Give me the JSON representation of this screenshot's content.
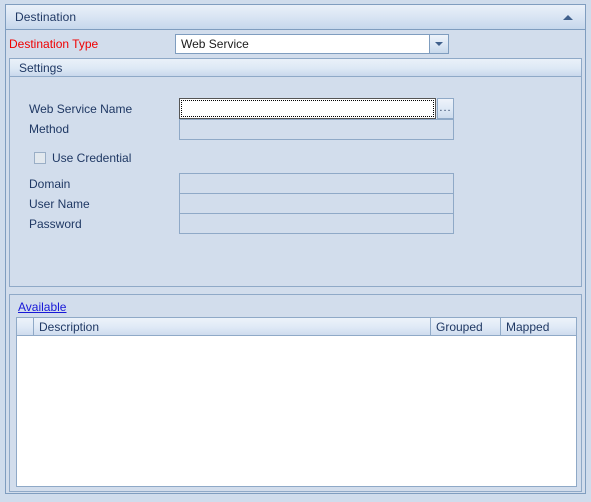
{
  "panel": {
    "title": "Destination",
    "collapse_icon": "chevron-up-icon"
  },
  "destination_type": {
    "label": "Destination Type",
    "label_color": "#f00000",
    "value": "Web Service",
    "dropdown_icon": "chevron-down-icon",
    "options": [
      "Web Service"
    ]
  },
  "settings": {
    "title": "Settings",
    "web_service_name": {
      "label": "Web Service Name",
      "value": "",
      "focused": true,
      "browse_label": "...",
      "browse_icon": "ellipsis-icon"
    },
    "method": {
      "label": "Method",
      "value": "",
      "disabled": true
    },
    "use_credential": {
      "label": "Use Credential",
      "checked": false
    },
    "domain": {
      "label": "Domain",
      "value": "",
      "disabled": true
    },
    "user_name": {
      "label": "User Name",
      "value": "",
      "disabled": true
    },
    "password": {
      "label": "Password",
      "value": "",
      "disabled": true
    }
  },
  "available": {
    "link_label": "Available ",
    "grid": {
      "columns": [
        "",
        "Description",
        "Grouped",
        "Mapped"
      ],
      "rows": []
    }
  },
  "colors": {
    "panel_bg": "#d2ddec",
    "border": "#8fa9c7",
    "header_border": "#7f9dbf",
    "text": "#1f3864",
    "required_label": "#f00000",
    "link": "#1818d8",
    "grid_bg": "#ffffff"
  }
}
